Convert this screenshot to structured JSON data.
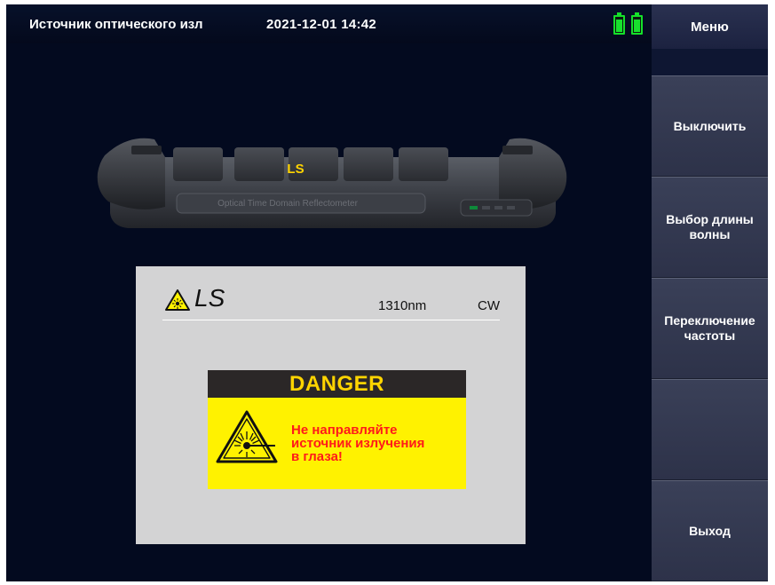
{
  "status_bar": {
    "title": "Источник оптического изл",
    "datetime": "2021-12-01 14:42",
    "battery_icons": [
      "battery-icon",
      "battery-icon"
    ]
  },
  "menu": {
    "header": "Меню",
    "softkeys": [
      {
        "lines": [
          "Выключить"
        ]
      },
      {
        "lines": [
          "Выбор длины",
          "волны"
        ]
      },
      {
        "lines": [
          "Переключение",
          "частоты"
        ]
      },
      {
        "lines": [
          ""
        ]
      },
      {
        "lines": [
          "Выход"
        ]
      }
    ]
  },
  "device_image": {
    "module_label": "LS",
    "model_text": "Optical Time Domain Reflectometer"
  },
  "light_source": {
    "title": "LS",
    "wavelength": "1310nm",
    "mode": "CW",
    "warning_icon": "laser-warning-icon"
  },
  "danger": {
    "heading": "DANGER",
    "message_lines": [
      "Не направляйте",
      "источник излучения",
      "в глаза!"
    ],
    "icon": "laser-hazard-icon"
  },
  "colors": {
    "screen_bg": "#030a1f",
    "softkey_bg": "#343a52",
    "battery": "#18e02e",
    "danger_yellow": "#fff200",
    "danger_text": "#ff1a1a",
    "module_label": "#ffd400"
  }
}
